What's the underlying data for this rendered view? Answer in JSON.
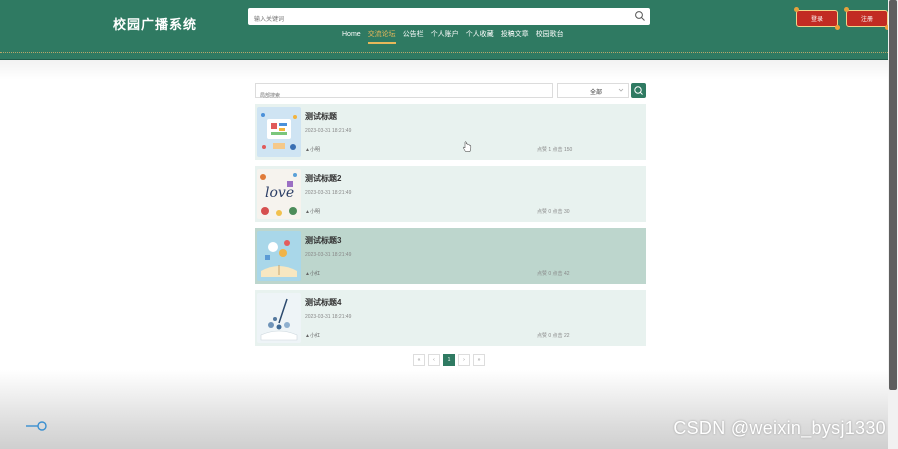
{
  "header": {
    "brand": "校园广播系统",
    "search_placeholder": "输入关键词",
    "nav": [
      {
        "label": "Home",
        "active": false
      },
      {
        "label": "交流论坛",
        "active": true
      },
      {
        "label": "公告栏",
        "active": false
      },
      {
        "label": "个人账户",
        "active": false
      },
      {
        "label": "个人收藏",
        "active": false
      },
      {
        "label": "投稿文章",
        "active": false
      },
      {
        "label": "校园歌台",
        "active": false
      }
    ],
    "login_label": "登录",
    "register_label": "注册"
  },
  "filter": {
    "placeholder": "局部搜索",
    "select_value": "全部"
  },
  "posts": [
    {
      "title": "测试标题",
      "date": "2023-03-31 18:21:49",
      "author": "小明",
      "stats": "点赞 1 点击 150",
      "highlight": false
    },
    {
      "title": "测试标题2",
      "date": "2023-03-31 18:21:49",
      "author": "小明",
      "stats": "点赞 0 点击 30",
      "highlight": false
    },
    {
      "title": "测试标题3",
      "date": "2023-03-31 18:21:49",
      "author": "小红",
      "stats": "点赞 0 点击 42",
      "highlight": true
    },
    {
      "title": "测试标题4",
      "date": "2023-03-31 18:21:49",
      "author": "小红",
      "stats": "点赞 0 点击 22",
      "highlight": false
    }
  ],
  "pager": {
    "first": "«",
    "prev": "‹",
    "current": "1",
    "next": "›",
    "last": "»"
  },
  "watermark": "CSDN @weixin_bysj1330",
  "colors": {
    "header_bg": "#2f7a62",
    "accent": "#e8b85a",
    "button_red": "#c22b23",
    "post_bg": "#e8f2ef",
    "post_highlight_bg": "#bdd6cd"
  }
}
